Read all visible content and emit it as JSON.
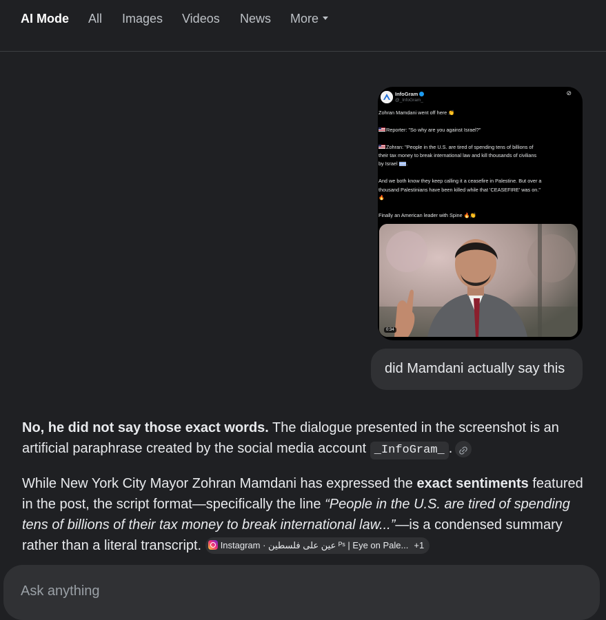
{
  "nav": {
    "tabs": [
      {
        "label": "AI Mode"
      },
      {
        "label": "All"
      },
      {
        "label": "Images"
      },
      {
        "label": "Videos"
      },
      {
        "label": "News"
      },
      {
        "label": "More"
      }
    ]
  },
  "tweet": {
    "name": "InfoGram",
    "handle": "@_InfoGram_",
    "line1": "Zohran Mamdani went off here 👏",
    "line2": "Reporter: \"So why are you against Israel?\"",
    "line3": "Zohran: \"People in the U.S. are tired of spending tens of billions of",
    "line4": "their tax money to break international law and kill thousands of civilians",
    "line5": "by Israel",
    "line6": "And we both know they keep calling it a ceasefire in Palestine. But over a",
    "line7": "thousand Palestinians have been killed while that 'CEASEFIRE' was on.\"",
    "line8": "🔥",
    "line9": "Finally an American leader with Spine 🔥👏",
    "duration": "0:34"
  },
  "user_query": "did Mamdani actually say this",
  "answer": {
    "p1_bold": "No, he did not say those exact words.",
    "p1_text": " The dialogue presented in the screenshot is an artificial paraphrase created by the social media account ",
    "p1_code": "_InfoGram_",
    "p1_end": ".",
    "p2_a": "While New York City Mayor Zohran Mamdani has expressed the ",
    "p2_bold": "exact sentiments",
    "p2_b": " featured in the post, the script format—specifically the line ",
    "p2_italic": "“People in the U.S. are tired of spending tens of billions of their tax money to break international law...”",
    "p2_c": "—is a condensed summary rather than a literal transcript.",
    "source_chip": "Instagram · عين على فلسطين ᴾˢ | Eye on Pale...",
    "source_more": "+1"
  },
  "ask": {
    "placeholder": "Ask anything"
  }
}
